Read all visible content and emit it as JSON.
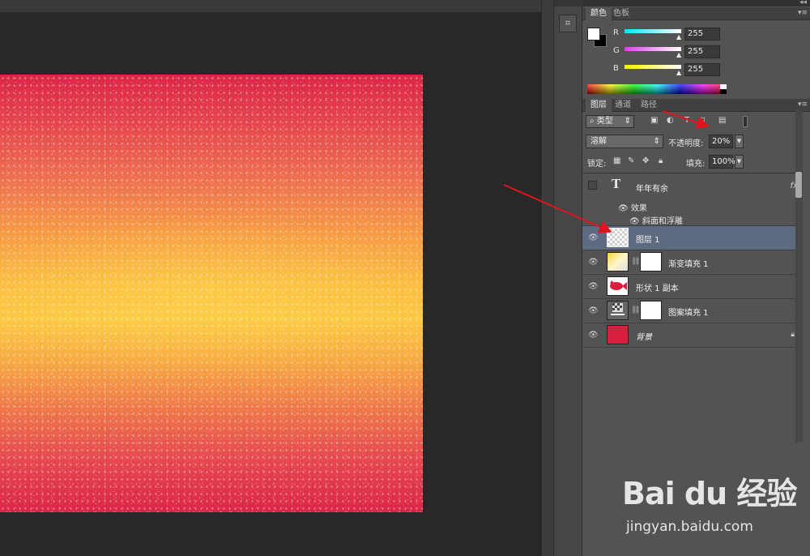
{
  "color_panel": {
    "tabs": [
      "颜色",
      "色板"
    ],
    "channels": [
      {
        "label": "R",
        "value": "255",
        "color": "#00e5ff"
      },
      {
        "label": "G",
        "value": "255",
        "color": "#e53cf0"
      },
      {
        "label": "B",
        "value": "255",
        "color": "#f5f000"
      }
    ],
    "foreground": "#ffffff",
    "background": "#000000"
  },
  "layers_panel": {
    "tabs": [
      "图层",
      "通道",
      "路径"
    ],
    "filter_label": "类型",
    "blend_mode": "溶解",
    "opacity_label": "不透明度:",
    "opacity_value": "20%",
    "lock_label": "锁定:",
    "fill_label": "填充:",
    "fill_value": "100%",
    "layers": [
      {
        "name": "年年有余",
        "type": "text",
        "fx": "fx",
        "effects_label": "效果",
        "effect_item": "斜面和浮雕"
      },
      {
        "name": "图层 1",
        "type": "pixel",
        "selected": true
      },
      {
        "name": "渐变填充 1",
        "type": "gradient-fill"
      },
      {
        "name": "形状 1 副本",
        "type": "shape"
      },
      {
        "name": "图案填充 1",
        "type": "pattern-fill"
      },
      {
        "name": "背景",
        "type": "background",
        "color": "#d81f3d"
      }
    ]
  },
  "canvas": {
    "colors": [
      "#dc2648",
      "#fbbe42"
    ]
  },
  "watermark": {
    "logo_text": "Bai du 经验",
    "url": "jingyan.baidu.com"
  },
  "annotation_color": "#e0141e"
}
